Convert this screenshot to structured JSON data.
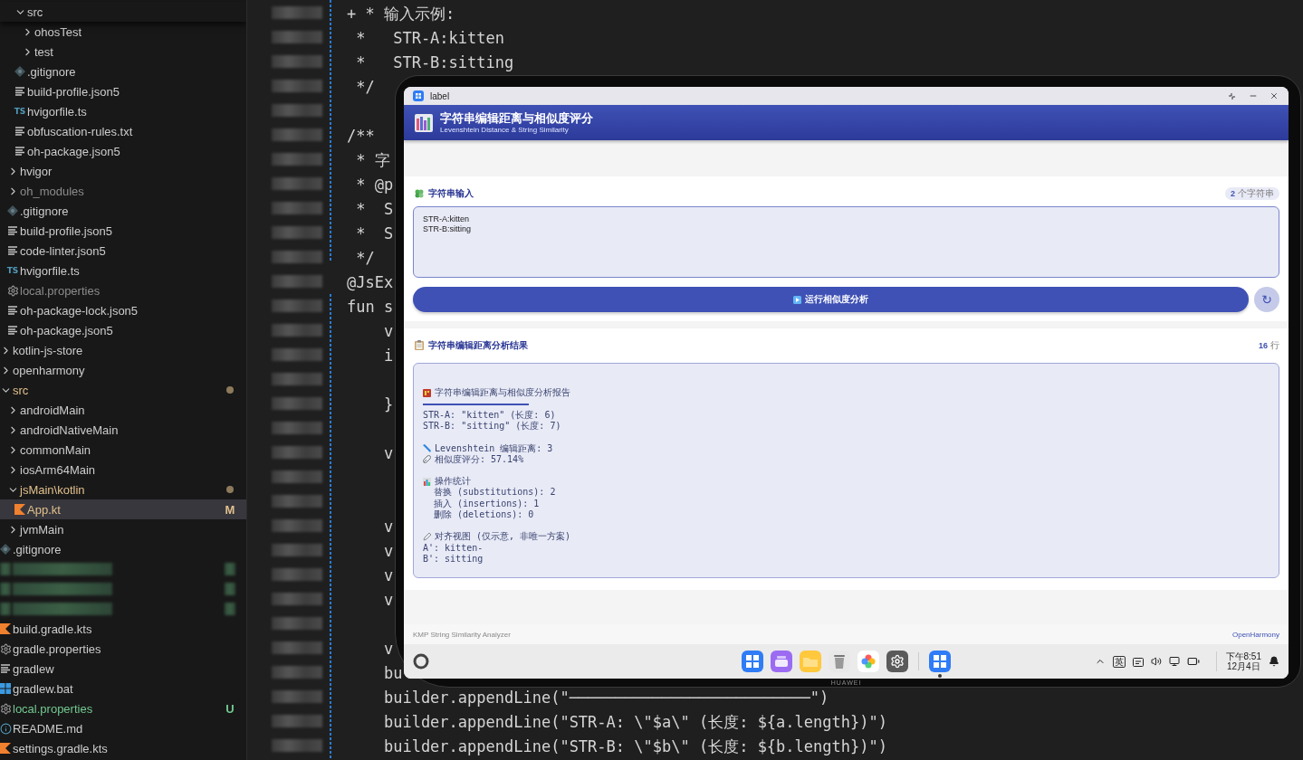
{
  "explorer": {
    "tree": [
      {
        "children": [
          {
            "children": [
              {
                "label": "src",
                "kind": "folder",
                "expanded": true,
                "selected": false,
                "children": [
                  {
                    "label": "ohosTest",
                    "kind": "folder",
                    "expanded": false,
                    "selected": false
                  },
                  {
                    "label": "test",
                    "kind": "folder",
                    "expanded": false,
                    "selected": false
                  }
                ]
              },
              {
                "label": ".gitignore",
                "kind": "git",
                "selected": false
              },
              {
                "label": "build-profile.json5",
                "kind": "lines",
                "selected": false
              },
              {
                "label": "hvigorfile.ts",
                "kind": "ts",
                "icon_label": "TS",
                "selected": false
              },
              {
                "label": "obfuscation-rules.txt",
                "kind": "lines",
                "selected": false
              },
              {
                "label": "oh-package.json5",
                "kind": "lines",
                "selected": false
              }
            ]
          },
          {
            "label": "hvigor",
            "kind": "folder",
            "expanded": false,
            "selected": false
          },
          {
            "label": "oh_modules",
            "kind": "folder",
            "expanded": false,
            "ignored": true,
            "selected": false
          },
          {
            "label": ".gitignore",
            "kind": "git",
            "selected": false
          },
          {
            "label": "build-profile.json5",
            "kind": "lines",
            "selected": false
          },
          {
            "label": "code-linter.json5",
            "kind": "lines",
            "selected": false
          },
          {
            "label": "hvigorfile.ts",
            "kind": "ts",
            "icon_label": "TS",
            "selected": false
          },
          {
            "label": "local.properties",
            "kind": "gear",
            "ignored": true,
            "selected": false
          },
          {
            "label": "oh-package-lock.json5",
            "kind": "lines",
            "selected": false
          },
          {
            "label": "oh-package.json5",
            "kind": "lines",
            "selected": false
          }
        ]
      },
      {
        "label": "kotlin-js-store",
        "kind": "folder",
        "expanded": false,
        "selected": false
      },
      {
        "label": "openharmony",
        "kind": "folder",
        "expanded": false,
        "selected": false
      },
      {
        "label": "src",
        "kind": "folder",
        "expanded": true,
        "modified": true,
        "selected": false,
        "children": [
          {
            "label": "androidMain",
            "kind": "folder",
            "expanded": false,
            "selected": false
          },
          {
            "label": "androidNativeMain",
            "kind": "folder",
            "expanded": false,
            "selected": false
          },
          {
            "label": "commonMain",
            "kind": "folder",
            "expanded": false,
            "selected": false
          },
          {
            "label": "iosArm64Main",
            "kind": "folder",
            "expanded": false,
            "selected": false
          },
          {
            "label": "jsMain\\kotlin",
            "kind": "folder",
            "expanded": true,
            "modified": true,
            "selected": false,
            "children": [
              {
                "label": "App.kt",
                "kind": "kotlin",
                "modified": true,
                "badge": "M",
                "selected": true
              }
            ]
          },
          {
            "label": "jvmMain",
            "kind": "folder",
            "expanded": false,
            "selected": false
          }
        ]
      },
      {
        "label": ".gitignore",
        "kind": "git",
        "selected": false
      },
      {
        "kind": "redacted"
      },
      {
        "kind": "redacted"
      },
      {
        "kind": "redacted"
      },
      {
        "label": "build.gradle.kts",
        "kind": "kotlin",
        "selected": false
      },
      {
        "label": "gradle.properties",
        "kind": "gear",
        "selected": false
      },
      {
        "label": "gradlew",
        "kind": "lines",
        "selected": false
      },
      {
        "label": "gradlew.bat",
        "kind": "windows",
        "selected": false
      },
      {
        "label": "local.properties",
        "kind": "gear",
        "untracked": true,
        "badge": "U",
        "selected": false
      },
      {
        "label": "README.md",
        "kind": "info",
        "selected": false
      },
      {
        "label": "settings.gradle.kts",
        "kind": "kotlin",
        "selected": false
      }
    ]
  },
  "editor": {
    "lines": [
      {
        "kind": "code",
        "text": "+ * 输入示例:"
      },
      {
        "kind": "code",
        "text": " *   STR-A:kitten"
      },
      {
        "kind": "code",
        "text": " *   STR-B:sitting"
      },
      {
        "kind": "code",
        "text": " */"
      },
      {
        "kind": "blank"
      },
      {
        "kind": "code",
        "text": "/**"
      },
      {
        "kind": "code",
        "text": " * 字"
      },
      {
        "kind": "code",
        "text": " * @p"
      },
      {
        "kind": "code",
        "text": " *  S"
      },
      {
        "kind": "code",
        "text": " *  S"
      },
      {
        "kind": "code",
        "text": " */"
      },
      {
        "kind": "code",
        "text": "@JsEx"
      },
      {
        "kind": "code",
        "text": "fun s"
      },
      {
        "kind": "code",
        "text": "    v"
      },
      {
        "kind": "code",
        "text": "    i"
      },
      {
        "kind": "blank"
      },
      {
        "kind": "code",
        "text": "    }"
      },
      {
        "kind": "blank"
      },
      {
        "kind": "code",
        "text": "    v"
      },
      {
        "kind": "blank"
      },
      {
        "kind": "blank"
      },
      {
        "kind": "code",
        "text": "    v"
      },
      {
        "kind": "code",
        "text": "    v"
      },
      {
        "kind": "code",
        "text": "    v"
      },
      {
        "kind": "code",
        "text": "    v"
      },
      {
        "kind": "blank"
      },
      {
        "kind": "code",
        "text": "    v"
      },
      {
        "kind": "code",
        "text": "    bu"
      },
      {
        "kind": "code",
        "text": "    builder.appendLine(\"──────────────────────────\")"
      },
      {
        "kind": "code",
        "text": "    builder.appendLine(\"STR-A: \\\"$a\\\" (长度: ${a.length})\")"
      },
      {
        "kind": "code",
        "text": "    builder.appendLine(\"STR-B: \\\"$b\\\" (长度: ${b.length})\")"
      }
    ]
  },
  "device": {
    "brand": "HUAWEI",
    "window": {
      "title": "label"
    },
    "app": {
      "title": "字符串编辑距离与相似度评分",
      "subtitle": "Levenshtein Distance & String Similarity",
      "input_card": {
        "heading": "字符串输入",
        "count": "2",
        "count_unit": "个字符串",
        "value": "STR-A:kitten\nSTR-B:sitting",
        "run_button": "运行相似度分析",
        "reset_button": "↻"
      },
      "result_card": {
        "heading": "字符串编辑距离分析结果",
        "count": "16",
        "count_unit": "行",
        "lines": [
          {
            "kind": "blank"
          },
          {
            "kind": "report-title",
            "text": "字符串编辑距离与相似度分析报告"
          },
          {
            "kind": "rule"
          },
          {
            "kind": "text",
            "text": "STR-A: \"kitten\" (长度: 6)"
          },
          {
            "kind": "text",
            "text": "STR-B: \"sitting\" (长度: 7)"
          },
          {
            "kind": "blank"
          },
          {
            "kind": "distance",
            "text": "Levenshtein 编辑距离: 3"
          },
          {
            "kind": "similarity",
            "text": "相似度评分: 57.14%"
          },
          {
            "kind": "blank"
          },
          {
            "kind": "stats",
            "text": "操作统计"
          },
          {
            "kind": "text",
            "text": "  替换 (substitutions): 2"
          },
          {
            "kind": "text",
            "text": "  插入 (insertions): 1"
          },
          {
            "kind": "text",
            "text": "  删除 (deletions): 0"
          },
          {
            "kind": "blank"
          },
          {
            "kind": "alignment",
            "text": "对齐视图 (仅示意, 非唯一方案)"
          },
          {
            "kind": "text",
            "text": "A': kitten-"
          },
          {
            "kind": "text",
            "text": "B': sitting"
          }
        ]
      },
      "footer": {
        "left": "KMP String Similarity Analyzer",
        "right": "OpenHarmony"
      }
    },
    "dock": {
      "apps": [
        {
          "kind": "grid"
        },
        {
          "kind": "cards"
        },
        {
          "kind": "folder"
        },
        {
          "kind": "trash"
        },
        {
          "kind": "photos"
        },
        {
          "kind": "settings"
        },
        {
          "kind": "separator"
        },
        {
          "kind": "grid",
          "running": true
        }
      ],
      "tray": {
        "ime": "英",
        "time": "下午8:51",
        "date": "12月4日"
      }
    }
  }
}
